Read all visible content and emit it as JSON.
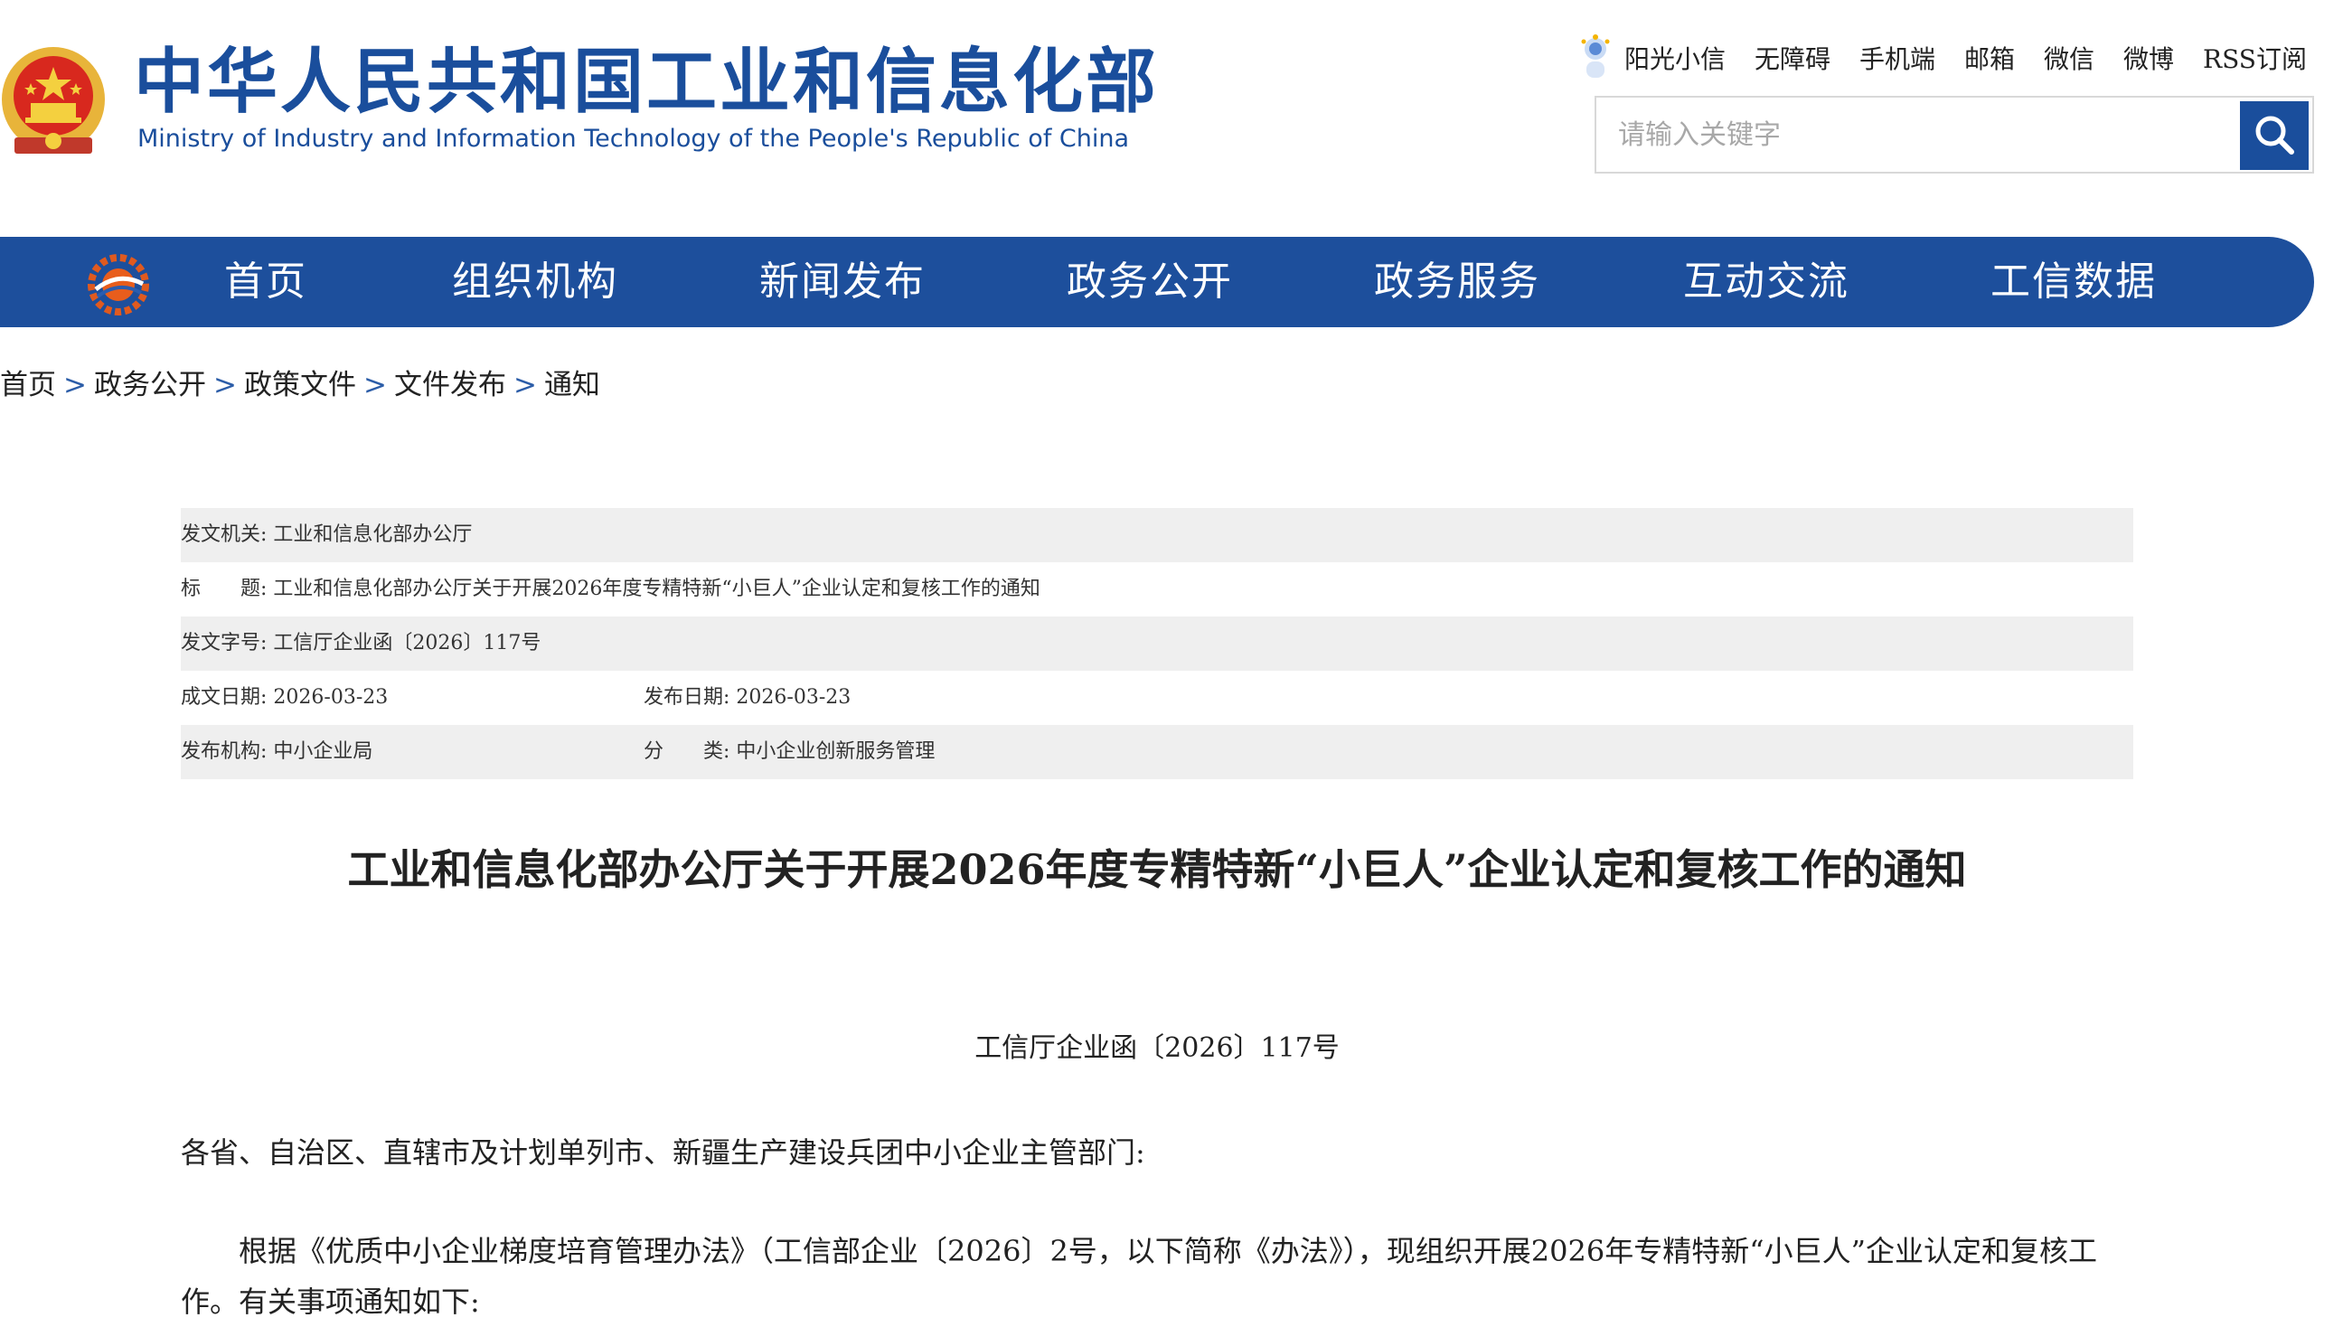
{
  "header": {
    "site_title_cn": "中华人民共和国工业和信息化部",
    "site_title_en": "Ministry of Industry and Information Technology of the People's Republic of China",
    "top_links": [
      "阳光小信",
      "无障碍",
      "手机端",
      "邮箱",
      "微信",
      "微博",
      "RSS订阅"
    ],
    "search": {
      "placeholder": "请输入关键字",
      "value": ""
    }
  },
  "nav": {
    "items": [
      "首页",
      "组织机构",
      "新闻发布",
      "政务公开",
      "政务服务",
      "互动交流",
      "工信数据"
    ]
  },
  "breadcrumb": [
    "首页",
    "政务公开",
    "政策文件",
    "文件发布",
    "通知"
  ],
  "breadcrumb_sep": ">",
  "meta": {
    "issuer_label": "发文机关:",
    "issuer": "工业和信息化部办公厅",
    "title_label": "标　　题:",
    "title": "工业和信息化部办公厅关于开展2026年度专精特新“小巨人”企业认定和复核工作的通知",
    "doc_no_label": "发文字号:",
    "doc_no": "工信厅企业函〔2026〕117号",
    "written_label": "成文日期:",
    "written_date": "2026-03-23",
    "published_label": "发布日期:",
    "published_date": "2026-03-23",
    "agency_label": "发布机构:",
    "agency": "中小企业局",
    "category_label": "分　　类:",
    "category": "中小企业创新服务管理"
  },
  "document": {
    "title": "工业和信息化部办公厅关于开展2026年度专精特新“小巨人”企业认定和复核工作的通知",
    "number": "工信厅企业函〔2026〕117号",
    "addressee": "各省、自治区、直辖市及计划单列市、新疆生产建设兵团中小企业主管部门:",
    "paragraph": "根据《优质中小企业梯度培育管理办法》（工信部企业〔2026〕2号，以下简称《办法》），现组织开展2026年专精特新“小巨人”企业认定和复核工作。有关事项通知如下:"
  },
  "colors": {
    "brand_blue": "#1d4f9c",
    "meta_shade": "#efefef",
    "emblem_red": "#d8281e",
    "emblem_gold": "#f1c232"
  },
  "icons": {
    "search": "search-icon",
    "emblem": "national-emblem-icon",
    "nav_logo": "miit-logo-icon",
    "sun": "sunshine-mascot-icon"
  }
}
